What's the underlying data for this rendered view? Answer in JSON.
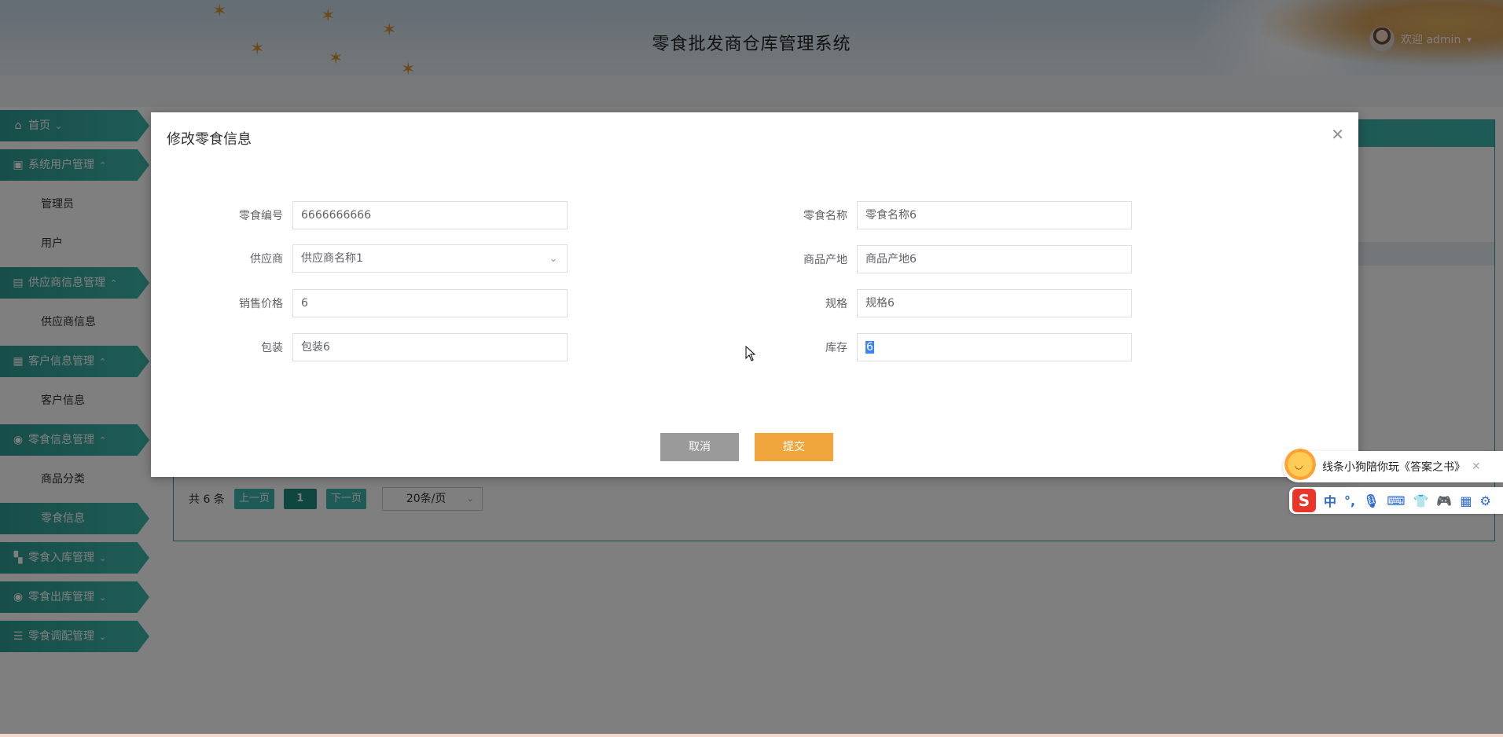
{
  "header": {
    "title": "零食批发商仓库管理系统",
    "welcome": "欢迎 admin"
  },
  "sidebar": {
    "items": [
      {
        "label": "首页",
        "type": "head",
        "icon": "home-icon"
      },
      {
        "label": "系统用户管理",
        "type": "head",
        "icon": "user-group-icon"
      },
      {
        "label": "管理员",
        "type": "sub"
      },
      {
        "label": "用户",
        "type": "sub"
      },
      {
        "label": "供应商信息管理",
        "type": "head",
        "icon": "supplier-icon"
      },
      {
        "label": "供应商信息",
        "type": "sub"
      },
      {
        "label": "客户信息管理",
        "type": "head",
        "icon": "customer-icon"
      },
      {
        "label": "客户信息",
        "type": "sub"
      },
      {
        "label": "零食信息管理",
        "type": "head",
        "icon": "snack-icon"
      },
      {
        "label": "商品分类",
        "type": "sub"
      },
      {
        "label": "零食信息",
        "type": "sub",
        "active": true
      },
      {
        "label": "零食入库管理",
        "type": "head",
        "icon": "inbound-icon"
      },
      {
        "label": "零食出库管理",
        "type": "head",
        "icon": "outbound-icon"
      },
      {
        "label": "零食调配管理",
        "type": "head",
        "icon": "allocation-icon"
      }
    ]
  },
  "pager": {
    "total": "共 6 条",
    "prev": "上一页",
    "page": "1",
    "next": "下一页",
    "size": "20条/页"
  },
  "dialog": {
    "title": "修改零食信息",
    "fields": {
      "code": {
        "label": "零食编号",
        "value": "6666666666"
      },
      "name": {
        "label": "零食名称",
        "value": "零食名称6"
      },
      "supplier": {
        "label": "供应商",
        "value": "供应商名称1"
      },
      "origin": {
        "label": "商品产地",
        "value": "商品产地6"
      },
      "price": {
        "label": "销售价格",
        "value": "6"
      },
      "spec": {
        "label": "规格",
        "value": "规格6"
      },
      "pack": {
        "label": "包装",
        "value": "包装6"
      },
      "stock": {
        "label": "库存",
        "value": "6"
      }
    },
    "cancel": "取消",
    "submit": "提交"
  },
  "ime": {
    "tip": "线条小狗陪你玩《答案之书》",
    "mode": "中",
    "punct": "°,"
  },
  "colors": {
    "teal": "#3fb7ac",
    "orange": "#f0a63d",
    "gray_button": "#9a9a9a"
  }
}
